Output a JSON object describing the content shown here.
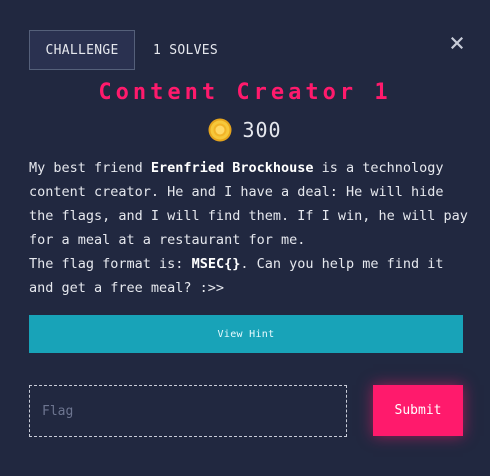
{
  "tabs": {
    "challenge_label": "CHALLENGE",
    "solves_label": "1 SOLVES"
  },
  "close_icon": "close-icon",
  "challenge": {
    "title": "Content Creator 1",
    "points": "300",
    "points_icon": "coin-icon"
  },
  "description": {
    "line1_pre": "My best friend ",
    "line1_name": "Erenfried Brockhouse",
    "line1_post": " is a technology content creator. He and I have a deal: He will hide the flags, and I will find them. If I win, he will pay for a meal at a restaurant for me.",
    "line2_pre": "The flag format is: ",
    "line2_format": "MSEC{}",
    "line2_post": ". Can you help me find it and get a free meal? :>>"
  },
  "hint": {
    "label": "View Hint"
  },
  "flag_form": {
    "placeholder": "Flag",
    "value": "",
    "submit_label": "Submit"
  },
  "colors": {
    "background": "#212840",
    "accent": "#ff1a6c",
    "hint_button": "#18a3b8",
    "coin": "#f2c230"
  }
}
